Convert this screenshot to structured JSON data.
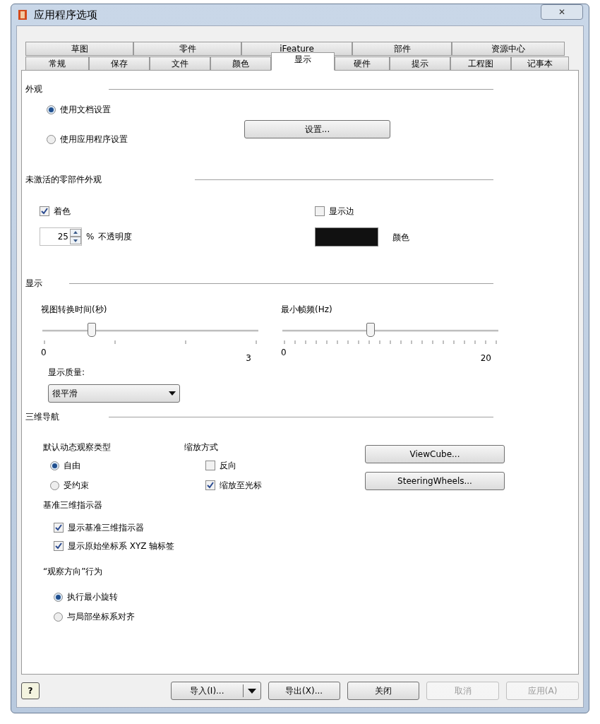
{
  "window": {
    "title": "应用程序选项",
    "close": "✕"
  },
  "tab_rows": [
    [
      {
        "label": "草图",
        "selected": false
      },
      {
        "label": "零件",
        "selected": false
      },
      {
        "label": "iFeature",
        "selected": false
      },
      {
        "label": "部件",
        "selected": false
      },
      {
        "label": "资源中心",
        "selected": false
      }
    ],
    [
      {
        "label": "常规",
        "selected": false
      },
      {
        "label": "保存",
        "selected": false
      },
      {
        "label": "文件",
        "selected": false
      },
      {
        "label": "颜色",
        "selected": false
      },
      {
        "label": "显示",
        "selected": true
      },
      {
        "label": "硬件",
        "selected": false
      },
      {
        "label": "提示",
        "selected": false
      },
      {
        "label": "工程图",
        "selected": false
      },
      {
        "label": "记事本",
        "selected": false
      }
    ]
  ],
  "appearance": {
    "title": "外观",
    "options": [
      {
        "label": "使用文档设置",
        "selected": true
      },
      {
        "label": "使用应用程序设置",
        "selected": false
      }
    ],
    "settings_button": "设置..."
  },
  "inactive": {
    "title": "未激活的零部件外观",
    "shading": {
      "label": "着色",
      "checked": true
    },
    "opacity": {
      "value": "25",
      "unit": "%",
      "label": "不透明度"
    },
    "show_edges": {
      "label": "显示边",
      "checked": false
    },
    "edge_color": {
      "color": "#111111",
      "label": "颜色"
    }
  },
  "display": {
    "title": "显示",
    "sliders": [
      {
        "label": "视图转换时间(秒)",
        "level": 0.23,
        "kind": "coarse",
        "min": "0",
        "max": "3"
      },
      {
        "label": "最小帧频(Hz)",
        "level": 0.41,
        "kind": "fine",
        "min": "0",
        "max": "20"
      }
    ],
    "quality_label": "显示质量:",
    "quality_value": "很平滑"
  },
  "nav3d": {
    "title": "三维导航",
    "orbit_label": "默认动态观察类型",
    "orbit": [
      {
        "label": "自由",
        "selected": true
      },
      {
        "label": "受约束",
        "selected": false
      }
    ],
    "zoom_label": "缩放方式",
    "zoom": [
      {
        "label": "反向",
        "checked": false
      },
      {
        "label": "缩放至光标",
        "checked": true
      }
    ],
    "buttons": [
      "ViewCube...",
      "SteeringWheels..."
    ],
    "indicator_label": "基准三维指示器",
    "indicator": [
      {
        "label": "显示基准三维指示器",
        "checked": true
      },
      {
        "label": "显示原始坐标系 XYZ 轴标签",
        "checked": true
      }
    ],
    "look_label": "“观察方向”行为",
    "look": [
      {
        "label": "执行最小旋转",
        "selected": true
      },
      {
        "label": "与局部坐标系对齐",
        "selected": false
      }
    ]
  },
  "footer": {
    "help": "?",
    "buttons": [
      {
        "label": "导入(I)...",
        "kind": "split",
        "disabled": false
      },
      {
        "label": "导出(X)...",
        "kind": "plain",
        "disabled": false
      },
      {
        "label": "关闭",
        "kind": "plain",
        "disabled": false
      },
      {
        "label": "取消",
        "kind": "plain",
        "disabled": true
      },
      {
        "label": "应用(A)",
        "kind": "plain",
        "disabled": true
      }
    ]
  }
}
